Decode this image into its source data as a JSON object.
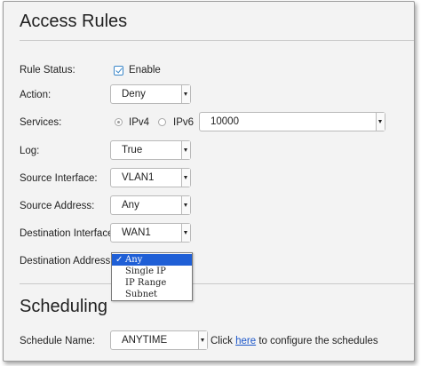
{
  "access_rules": {
    "title": "Access Rules",
    "rule_status": {
      "label": "Rule Status:",
      "checkbox_label": "Enable",
      "checked": true
    },
    "action": {
      "label": "Action:",
      "value": "Deny"
    },
    "services": {
      "label": "Services:",
      "ipv4_label": "IPv4",
      "ipv6_label": "IPv6",
      "selected": "IPv4",
      "value": "10000"
    },
    "log": {
      "label": "Log:",
      "value": "True"
    },
    "source_interface": {
      "label": "Source Interface:",
      "value": "VLAN1"
    },
    "source_address": {
      "label": "Source Address:",
      "value": "Any"
    },
    "destination_interface": {
      "label": "Destination Interface:",
      "value": "WAN1"
    },
    "destination_address": {
      "label": "Destination Address:",
      "options": [
        "Any",
        "Single IP",
        "IP Range",
        "Subnet"
      ],
      "selected": "Any",
      "check_glyph": "✓"
    }
  },
  "scheduling": {
    "title": "Scheduling",
    "schedule_name": {
      "label": "Schedule Name:",
      "value": "ANYTIME"
    },
    "click_text": "Click",
    "link_text": "here",
    "suffix_text": "to configure the schedules"
  },
  "colors": {
    "link": "#1a55c9",
    "accent": "#3a86c8",
    "selected_option": "#1f5fd6"
  }
}
